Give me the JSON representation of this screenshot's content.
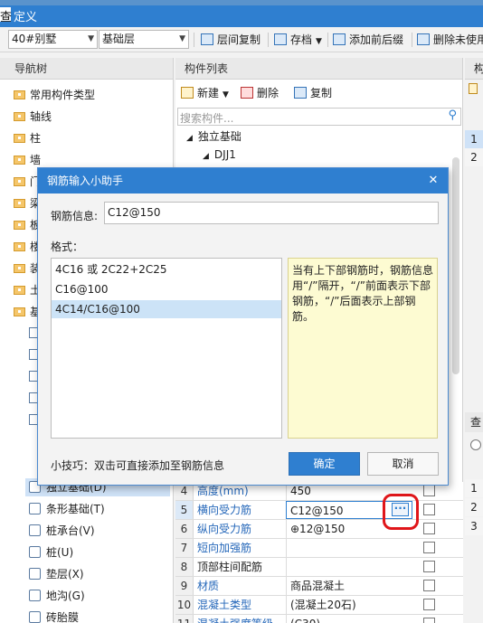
{
  "window": {
    "title": "定义",
    "ghost_text": "查"
  },
  "toolbar": {
    "floor_select": "40#别墅",
    "layer_select": "基础层",
    "btn_copy_floor": "层间复制",
    "btn_archive": "存档",
    "btn_add_suffix": "添加前后缀",
    "btn_delete_unused": "删除未使用"
  },
  "nav": {
    "header": "导航树",
    "items": [
      "常用构件类型",
      "轴线",
      "柱",
      "墙",
      "门",
      "梁",
      "板",
      "楼",
      "装",
      "土",
      "基"
    ],
    "sub_items": [
      "独立基础(D)",
      "条形基础(T)",
      "桩承台(V)",
      "桩(U)",
      "垫层(X)",
      "地沟(G)",
      "砖胎膜"
    ]
  },
  "component_list": {
    "header": "构件列表",
    "btn_new": "新建",
    "btn_delete": "删除",
    "btn_copy": "复制",
    "search_placeholder": "搜索构件...",
    "tree_root": "独立基础",
    "tree_child": "DJJ1"
  },
  "right_panel": {
    "header_partial": "构",
    "rows": [
      "1",
      "2"
    ],
    "bottom_label": "查",
    "bottom_rows": [
      "1",
      "2",
      "3"
    ]
  },
  "property_rows": [
    {
      "no": "4",
      "name": "高度(mm)",
      "value": "450",
      "blue": true
    },
    {
      "no": "5",
      "name": "横向受力筋",
      "value": "C12@150",
      "blue": true
    },
    {
      "no": "6",
      "name": "纵向受力筋",
      "value": "⊕12@150",
      "blue": true
    },
    {
      "no": "7",
      "name": "短向加强筋",
      "value": "",
      "blue": true
    },
    {
      "no": "8",
      "name": "顶部柱间配筋",
      "value": "",
      "blue": false
    },
    {
      "no": "9",
      "name": "材质",
      "value": "商品混凝土",
      "blue": true
    },
    {
      "no": "10",
      "name": "混凝土类型",
      "value": "(混凝土20石)",
      "blue": true
    },
    {
      "no": "11",
      "name": "混凝土强度等级",
      "value": "(C30)",
      "blue": true
    }
  ],
  "dialog": {
    "title": "钢筋输入小助手",
    "info_label": "钢筋信息:",
    "info_value": "C12@150",
    "format_label": "格式：",
    "formats": [
      "4C16 或 2C22+2C25",
      "C16@100",
      "4C14/C16@100"
    ],
    "selected_index": 2,
    "description": "当有上下部钢筋时，钢筋信息用“/”隔开，“/”前面表示下部钢筋，“/”后面表示上部钢筋。",
    "tip": "小技巧：双击可直接添加至钢筋信息",
    "ok": "确定",
    "cancel": "取消"
  },
  "colors": {
    "accent": "#2f7fd0",
    "annotation": "#e0161a",
    "note_bg": "#fdfbd2"
  }
}
